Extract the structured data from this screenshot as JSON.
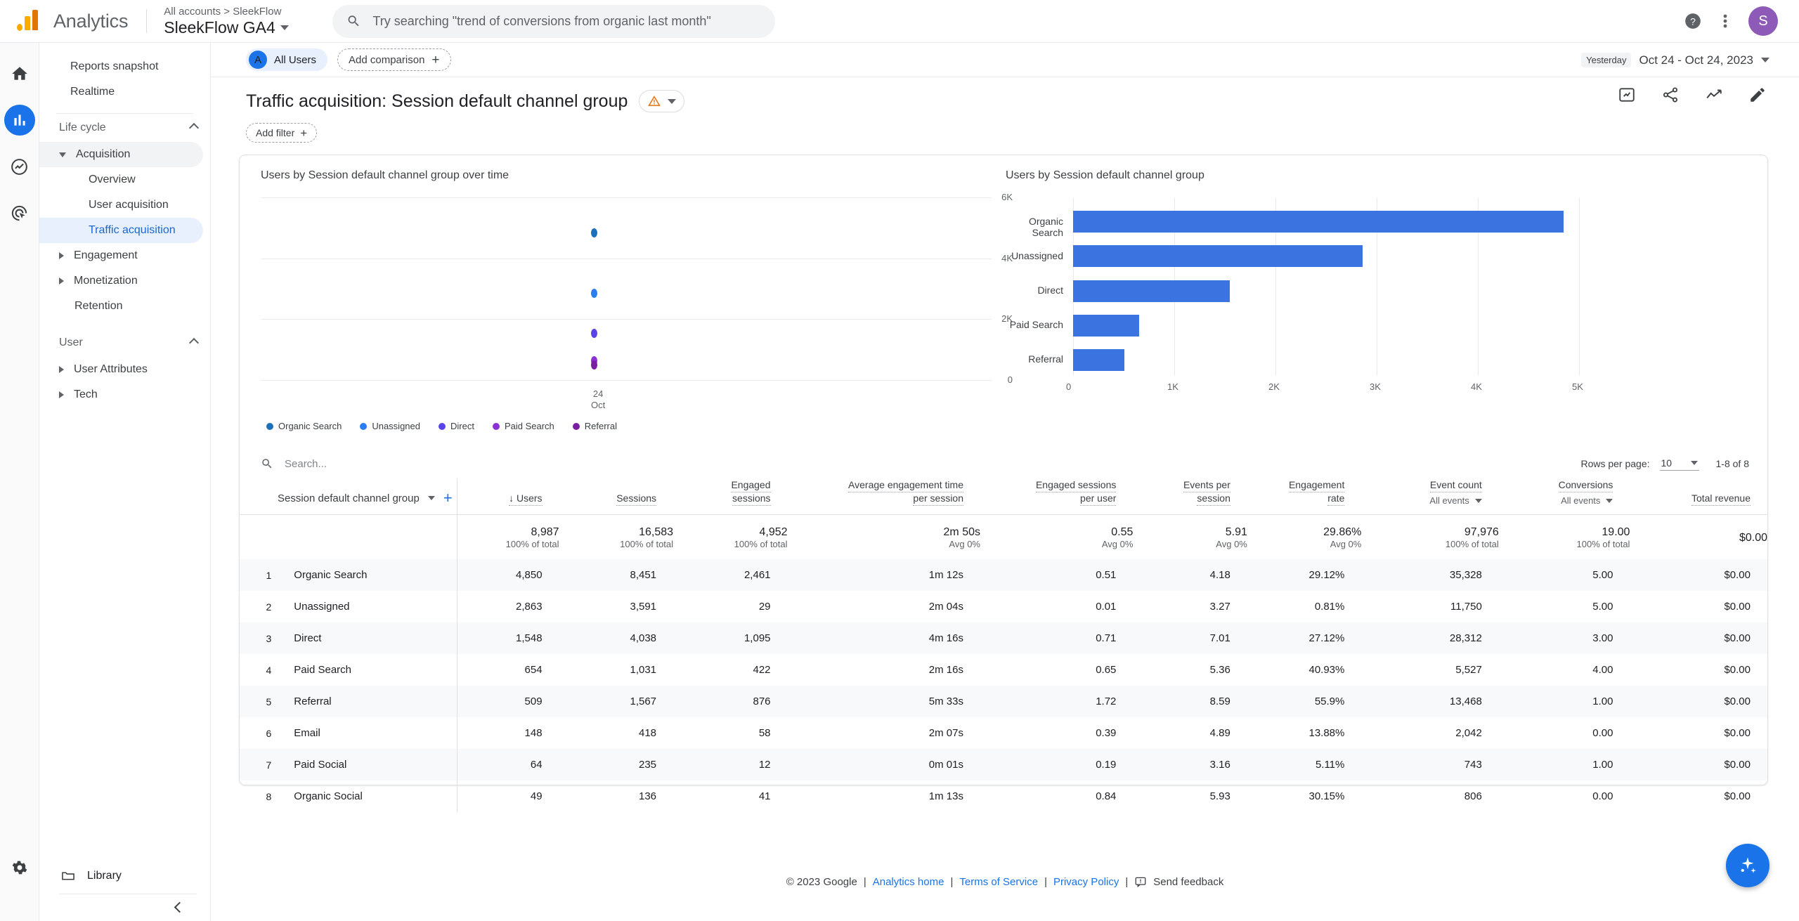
{
  "topbar": {
    "brand": "Analytics",
    "account_breadcrumb": "All accounts > SleekFlow",
    "property_name": "SleekFlow GA4",
    "search_placeholder": "Try searching \"trend of conversions from organic last month\"",
    "avatar_initial": "S"
  },
  "nav": {
    "reports_snapshot": "Reports snapshot",
    "realtime": "Realtime",
    "life_cycle": "Life cycle",
    "acquisition": "Acquisition",
    "overview": "Overview",
    "user_acquisition": "User acquisition",
    "traffic_acquisition": "Traffic acquisition",
    "engagement": "Engagement",
    "monetization": "Monetization",
    "retention": "Retention",
    "user": "User",
    "user_attributes": "User Attributes",
    "tech": "Tech",
    "library": "Library"
  },
  "comparison": {
    "all_users": "All Users",
    "all_users_initial": "A",
    "add_comparison": "Add comparison"
  },
  "daterange": {
    "badge": "Yesterday",
    "label": "Oct 24 - Oct 24, 2023"
  },
  "header": {
    "title": "Traffic acquisition: Session default channel group",
    "add_filter": "Add filter"
  },
  "chart_data": [
    {
      "type": "scatter",
      "title": "Users by Session default channel group over time",
      "xlabel": "",
      "ylabel": "",
      "x": [
        "24\nOct"
      ],
      "xtick_labels": [
        "24",
        "Oct"
      ],
      "ylim": [
        0,
        6000
      ],
      "yticks": [
        0,
        2000,
        4000,
        6000
      ],
      "ytick_labels": [
        "0",
        "2K",
        "4K",
        "6K"
      ],
      "grid": true,
      "legend_position": "bottom",
      "series": [
        {
          "name": "Organic Search",
          "color": "#1c6fbb",
          "values": [
            4850
          ]
        },
        {
          "name": "Unassigned",
          "color": "#2a7ef0",
          "values": [
            2863
          ]
        },
        {
          "name": "Direct",
          "color": "#5944e8",
          "values": [
            1548
          ]
        },
        {
          "name": "Paid Search",
          "color": "#8b31d6",
          "values": [
            654
          ]
        },
        {
          "name": "Referral",
          "color": "#7b1fa2",
          "values": [
            509
          ]
        }
      ]
    },
    {
      "type": "bar",
      "orientation": "horizontal",
      "title": "Users by Session default channel group",
      "categories": [
        "Organic Search",
        "Unassigned",
        "Direct",
        "Paid Search",
        "Referral"
      ],
      "values": [
        4850,
        2863,
        1548,
        654,
        509
      ],
      "color": "#3b74e0",
      "xlim": [
        0,
        5000
      ],
      "xticks": [
        0,
        1000,
        2000,
        3000,
        4000,
        5000
      ],
      "xtick_labels": [
        "0",
        "1K",
        "2K",
        "3K",
        "4K",
        "5K"
      ],
      "grid": true,
      "xlabel": "",
      "ylabel": ""
    }
  ],
  "table": {
    "search_placeholder": "Search...",
    "rows_per_page_label": "Rows per page:",
    "rows_per_page_value": "10",
    "pagination": "1-8 of 8",
    "dimension_header": "Session default channel group",
    "columns": [
      {
        "line1": "Users",
        "line2": "",
        "sorted": true
      },
      {
        "line1": "Sessions",
        "line2": ""
      },
      {
        "line1": "Engaged",
        "line2": "sessions"
      },
      {
        "line1": "Average engagement time",
        "line2": "per session"
      },
      {
        "line1": "Engaged sessions",
        "line2": "per user"
      },
      {
        "line1": "Events per",
        "line2": "session"
      },
      {
        "line1": "Engagement",
        "line2": "rate"
      },
      {
        "line1": "Event count",
        "line2": "All events",
        "dropdown": true
      },
      {
        "line1": "Conversions",
        "line2": "All events",
        "dropdown": true
      },
      {
        "line1": "Total revenue",
        "line2": ""
      }
    ],
    "totals": [
      {
        "value": "8,987",
        "sub": "100% of total"
      },
      {
        "value": "16,583",
        "sub": "100% of total"
      },
      {
        "value": "4,952",
        "sub": "100% of total"
      },
      {
        "value": "2m 50s",
        "sub": "Avg 0%"
      },
      {
        "value": "0.55",
        "sub": "Avg 0%"
      },
      {
        "value": "5.91",
        "sub": "Avg 0%"
      },
      {
        "value": "29.86%",
        "sub": "Avg 0%"
      },
      {
        "value": "97,976",
        "sub": "100% of total"
      },
      {
        "value": "19.00",
        "sub": "100% of total"
      },
      {
        "value": "$0.00",
        "sub": ""
      }
    ],
    "rows": [
      {
        "idx": "1",
        "name": "Organic Search",
        "cells": [
          "4,850",
          "8,451",
          "2,461",
          "1m 12s",
          "0.51",
          "4.18",
          "29.12%",
          "35,328",
          "5.00",
          "$0.00"
        ]
      },
      {
        "idx": "2",
        "name": "Unassigned",
        "cells": [
          "2,863",
          "3,591",
          "29",
          "2m 04s",
          "0.01",
          "3.27",
          "0.81%",
          "11,750",
          "5.00",
          "$0.00"
        ]
      },
      {
        "idx": "3",
        "name": "Direct",
        "cells": [
          "1,548",
          "4,038",
          "1,095",
          "4m 16s",
          "0.71",
          "7.01",
          "27.12%",
          "28,312",
          "3.00",
          "$0.00"
        ]
      },
      {
        "idx": "4",
        "name": "Paid Search",
        "cells": [
          "654",
          "1,031",
          "422",
          "2m 16s",
          "0.65",
          "5.36",
          "40.93%",
          "5,527",
          "4.00",
          "$0.00"
        ]
      },
      {
        "idx": "5",
        "name": "Referral",
        "cells": [
          "509",
          "1,567",
          "876",
          "5m 33s",
          "1.72",
          "8.59",
          "55.9%",
          "13,468",
          "1.00",
          "$0.00"
        ]
      },
      {
        "idx": "6",
        "name": "Email",
        "cells": [
          "148",
          "418",
          "58",
          "2m 07s",
          "0.39",
          "4.89",
          "13.88%",
          "2,042",
          "0.00",
          "$0.00"
        ]
      },
      {
        "idx": "7",
        "name": "Paid Social",
        "cells": [
          "64",
          "235",
          "12",
          "0m 01s",
          "0.19",
          "3.16",
          "5.11%",
          "743",
          "1.00",
          "$0.00"
        ]
      },
      {
        "idx": "8",
        "name": "Organic Social",
        "cells": [
          "49",
          "136",
          "41",
          "1m 13s",
          "0.84",
          "5.93",
          "30.15%",
          "806",
          "0.00",
          "$0.00"
        ]
      }
    ]
  },
  "footer": {
    "copyright": "© 2023 Google",
    "analytics_home": "Analytics home",
    "terms": "Terms of Service",
    "privacy": "Privacy Policy",
    "send_feedback": "Send feedback",
    "sep": "|"
  },
  "colors": {
    "accent": "#1a73e8",
    "bar": "#3b74e0",
    "selected_bg": "#e8f0fe",
    "warning": "#e8710a"
  }
}
